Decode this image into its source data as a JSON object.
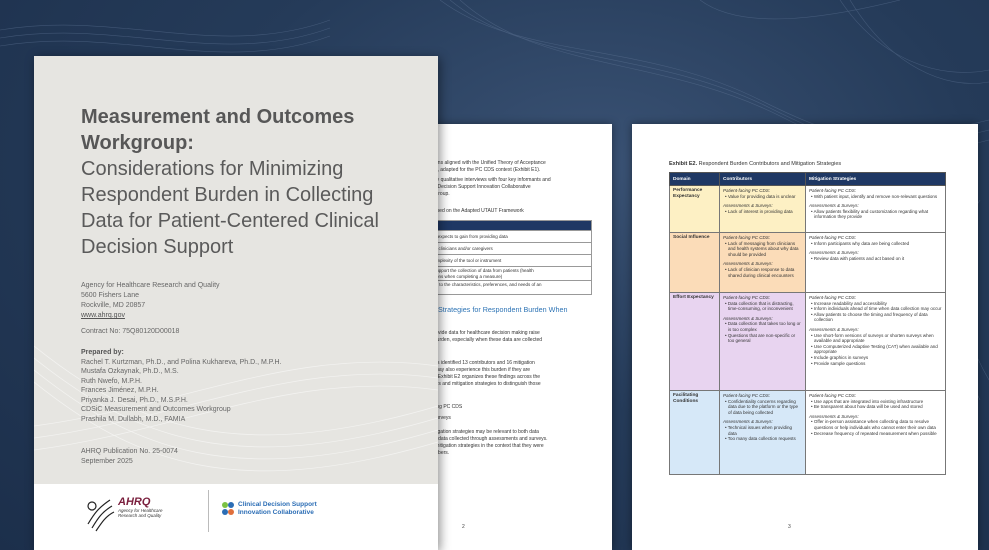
{
  "cover": {
    "title_bold_1": "Measurement and Outcomes",
    "title_bold_2": "Workgroup:",
    "title_reg_1": "Considerations for Minimizing",
    "title_reg_2": "Respondent Burden in Collecting",
    "title_reg_3": "Data for Patient-Centered Clinical",
    "title_reg_4": "Decision Support",
    "agency_1": "Agency for Healthcare Research and Quality",
    "agency_2": "5600 Fishers Lane",
    "agency_3": "Rockville, MD 20857",
    "agency_link": "www.ahrq.gov",
    "contract": "Contract No: 75Q80120D00018",
    "prepared_label": "Prepared by:",
    "prepared_1": "Rachel T. Kurtzman, Ph.D., and Polina Kukhareva, Ph.D., M.P.H.",
    "prepared_2": "Mustafa Ozkaynak, Ph.D., M.S.",
    "prepared_3": "Ruth Nwefo, M.P.H.",
    "prepared_4": "Frances Jiménez, M.P.H.",
    "prepared_5": "Priyanka J. Desai, Ph.D., M.S.P.H.",
    "prepared_6": "CDSiC Measurement and Outcomes Workgroup",
    "prepared_7": "Prashila M. Dullabh, M.D., FAMIA",
    "pub_1": "AHRQ Publication No. 25-0074",
    "pub_2": "September 2025",
    "ahrq_logo": "AHRQ",
    "ahrq_sub_1": "Agency for Healthcare",
    "ahrq_sub_2": "Research and Quality",
    "cds_1": "Clinical Decision Support",
    "cds_2": "Innovation Collaborative"
  },
  "page2": {
    "intro_1": "e domains aligned with the Unified Theory of Acceptance",
    "intro_2": "mework, adapted for the PC CDS context (Exhibit E1).",
    "intro_3": "ented by qualitative interviews with four key informants and",
    "intro_4": "Clinical Decision Support Innovation Collaborative",
    "intro_5": "s Workgroup.",
    "table_caption": "ains Based on the Adapted UTAUT Framework",
    "table_header": "on",
    "rows": [
      "patient expects to gain from providing data",
      "on with clinicians and/or caregivers",
      "use/complexity of the tool or instrument",
      "ns to support the collection of data from patients (health",
      "conditions when completing a measure)",
      "specific to the characteristics, preferences, and needs of an",
      "al"
    ],
    "heading_1": "Strategies for Respondent Burden When",
    "para1_1": "vers provide data for healthcare decision making raise",
    "para1_2": "ndent burden, especially when these data are collected",
    "para2_1": "cussions identified 13 contributors and 16 mitigation",
    "para2_2": "givers may also experience this burden if they are",
    "para2_3": "patient. Exhibit E2 organizes these findings across the",
    "para2_4": "ntributors and mitigation strategies to distinguish those",
    "list_1": "ent-facing PC CDS",
    "list_2": "s and surveys",
    "para3_1": "and mitigation strategies may be relevant to both data",
    "para3_2": "DS and data collected through assessments and surveys.",
    "para3_3": "rs and mitigation strategies in the context that they were",
    "para3_4": "up members.",
    "page_number": "2"
  },
  "page3": {
    "exhibit_label": "Exhibit E2.",
    "exhibit_title": " Respondent Burden Contributors and Mitigation Strategies",
    "col_domain": "Domain",
    "col_contributors": "Contributors",
    "col_mitigation": "Mitigation Strategies",
    "page_number": "3",
    "rows": [
      {
        "domain": "Performance Expectancy",
        "color": "#fdf0c4",
        "c_h1": "Patient-facing PC CDS:",
        "c_1": "Value for providing data is unclear",
        "c_h2": "Assessments & Surveys:",
        "c_2": "Lack of interest in providing data",
        "c_3": "",
        "c_4": "",
        "m_h1": "Patient-facing PC CDS:",
        "m_1": "With patient input, identify and remove non-relevant questions",
        "m_h2": "Assessments & Surveys:",
        "m_2": "Allow patients flexibility and customization regarding what information they provide",
        "m_3": "",
        "m_4": "",
        "m_5": ""
      },
      {
        "domain": "Social Influence",
        "color": "#fbdcb8",
        "c_h1": "Patient-facing PC CDS:",
        "c_1": "Lack of messaging from clinicians and health systems about why data should be provided",
        "c_h2": "Assessments & Surveys:",
        "c_2": "Lack of clinician response to data shared during clinical encounters",
        "c_3": "",
        "c_4": "",
        "m_h1": "Patient-facing PC CDS:",
        "m_1": "Inform participants why data are being collected",
        "m_h2": "Assessments & Surveys:",
        "m_2": "Review data with patients and act based on it",
        "m_3": "",
        "m_4": "",
        "m_5": ""
      },
      {
        "domain": "Effort Expectancy",
        "color": "#e8d4f0",
        "c_h1": "Patient-facing PC CDS:",
        "c_1": "Data collection that is distracting, time-consuming, or inconvenient",
        "c_h2": "Assessments & Surveys:",
        "c_2": "Data collection that takes too long or is too complex",
        "c_3": "Questions that are non-specific or too general",
        "c_4": "",
        "m_h1": "Patient-facing PC CDS:",
        "m_1": "Increase readability and accessibility",
        "m_1b": "Inform individuals ahead of time when data collection may occur",
        "m_1c": "Allow patients to choose the timing and frequency of data collection",
        "m_h2": "Assessments & Surveys:",
        "m_2": "Use short-form versions of surveys or shorten surveys when available and appropriate",
        "m_3": "Use Computerized Adaptive Testing (CAT) when available and appropriate",
        "m_4": "Include graphics in surveys",
        "m_5": "Provide sample questions"
      },
      {
        "domain": "Facilitating Conditions",
        "color": "#d6e8f8",
        "c_h1": "Patient-facing PC CDS:",
        "c_1": "Confidentiality concerns regarding data due to the platform or the type of data being collected",
        "c_h2": "Assessments & Surveys:",
        "c_2": "Technical issues when providing data",
        "c_3": "Too many data collection requests",
        "c_4": "",
        "m_h1": "Patient-facing PC CDS:",
        "m_1": "Use apps that are integrated into existing infrastructure",
        "m_1b": "Be transparent about how data will be used and stored",
        "m_h2": "Assessments & Surveys:",
        "m_2": "Offer in-person assistance when collecting data to resolve questions or help individuals who cannot enter their own data",
        "m_3": "Decrease frequency of repeated measurement when possible",
        "m_4": "",
        "m_5": ""
      }
    ]
  }
}
